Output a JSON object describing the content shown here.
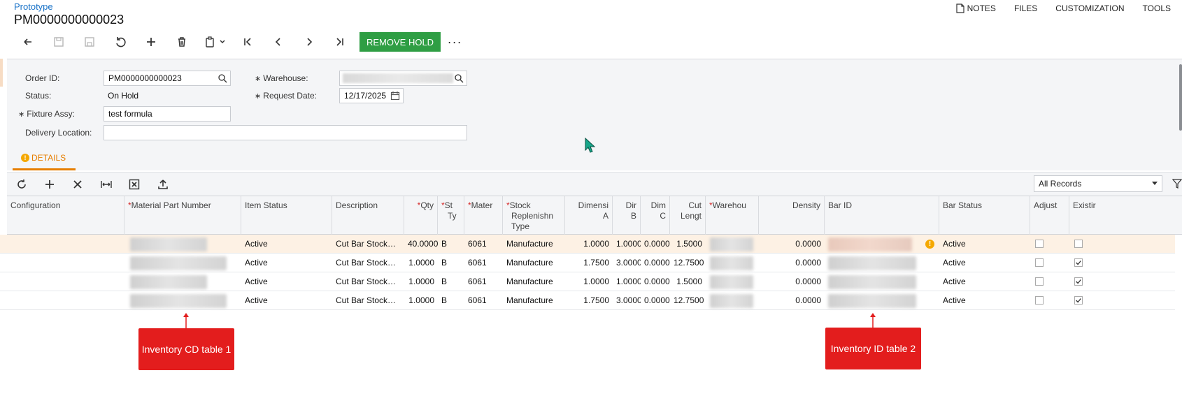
{
  "header": {
    "breadcrumb": "Prototype",
    "title": "PM0000000000023",
    "links": [
      "NOTES",
      "FILES",
      "CUSTOMIZATION",
      "TOOLS"
    ]
  },
  "toolbar": {
    "remove_hold_label": "REMOVE HOLD",
    "more_label": "···",
    "accent_color": "#2f9e44"
  },
  "form": {
    "order_id_label": "Order ID:",
    "order_id_value": "PM0000000000023",
    "status_label": "Status:",
    "status_value": "On Hold",
    "fixture_label": "Fixture Assy:",
    "fixture_value": "test formula",
    "delivery_label": "Delivery Location:",
    "delivery_value": "",
    "warehouse_label": "Warehouse:",
    "request_date_label": "Request Date:",
    "request_date_value": "12/17/2025"
  },
  "tabs": {
    "details": "DETAILS",
    "accent_color": "#e67e00"
  },
  "grid_toolbar": {
    "filter_value": "All Records"
  },
  "grid": {
    "columns": {
      "configuration": "Configuration",
      "material_part_number": "Material Part Number",
      "item_status": "Item Status",
      "description": "Description",
      "qty": "Qty",
      "st_ty_1": "St",
      "st_ty_2": "Ty",
      "mater": "Mater",
      "stock_repl_1": "Stock",
      "stock_repl_2": "Replenishn",
      "stock_repl_3": "Type",
      "dim_a_1": "Dimensi",
      "dim_a_2": "A",
      "dim_b_1": "Dir",
      "dim_b_2": "B",
      "dim_c_1": "Dim",
      "dim_c_2": "C",
      "cut_1": "Cut",
      "cut_2": "Lengt",
      "warehouse": "Warehou",
      "density": "Density",
      "bar_id": "Bar ID",
      "bar_status": "Bar Status",
      "adjust": "Adjust",
      "existing": "Existir"
    },
    "rows": [
      {
        "item_status": "Active",
        "description": "Cut Bar Stock…",
        "qty": "40.0000",
        "st": "B",
        "mater": "6061",
        "repl": "Manufacture",
        "dim_a": "1.0000",
        "dim_b": "1.0000",
        "dim_c": "0.0000",
        "cut": "1.5000",
        "density": "0.0000",
        "bar_status": "Active",
        "adjust": false,
        "existing": false,
        "warning": true
      },
      {
        "item_status": "Active",
        "description": "Cut Bar Stock…",
        "qty": "1.0000",
        "st": "B",
        "mater": "6061",
        "repl": "Manufacture",
        "dim_a": "1.7500",
        "dim_b": "3.0000",
        "dim_c": "0.0000",
        "cut": "12.7500",
        "density": "0.0000",
        "bar_status": "Active",
        "adjust": false,
        "existing": true,
        "warning": false
      },
      {
        "item_status": "Active",
        "description": "Cut Bar Stock…",
        "qty": "1.0000",
        "st": "B",
        "mater": "6061",
        "repl": "Manufacture",
        "dim_a": "1.0000",
        "dim_b": "1.0000",
        "dim_c": "0.0000",
        "cut": "1.5000",
        "density": "0.0000",
        "bar_status": "Active",
        "adjust": false,
        "existing": true,
        "warning": false
      },
      {
        "item_status": "Active",
        "description": "Cut Bar Stock…",
        "qty": "1.0000",
        "st": "B",
        "mater": "6061",
        "repl": "Manufacture",
        "dim_a": "1.7500",
        "dim_b": "3.0000",
        "dim_c": "0.0000",
        "cut": "12.7500",
        "density": "0.0000",
        "bar_status": "Active",
        "adjust": false,
        "existing": true,
        "warning": false
      }
    ]
  },
  "annotations": {
    "callout_1": "Inventory CD table 1",
    "callout_2": "Inventory ID table 2",
    "callout_color": "#e31d1d"
  }
}
